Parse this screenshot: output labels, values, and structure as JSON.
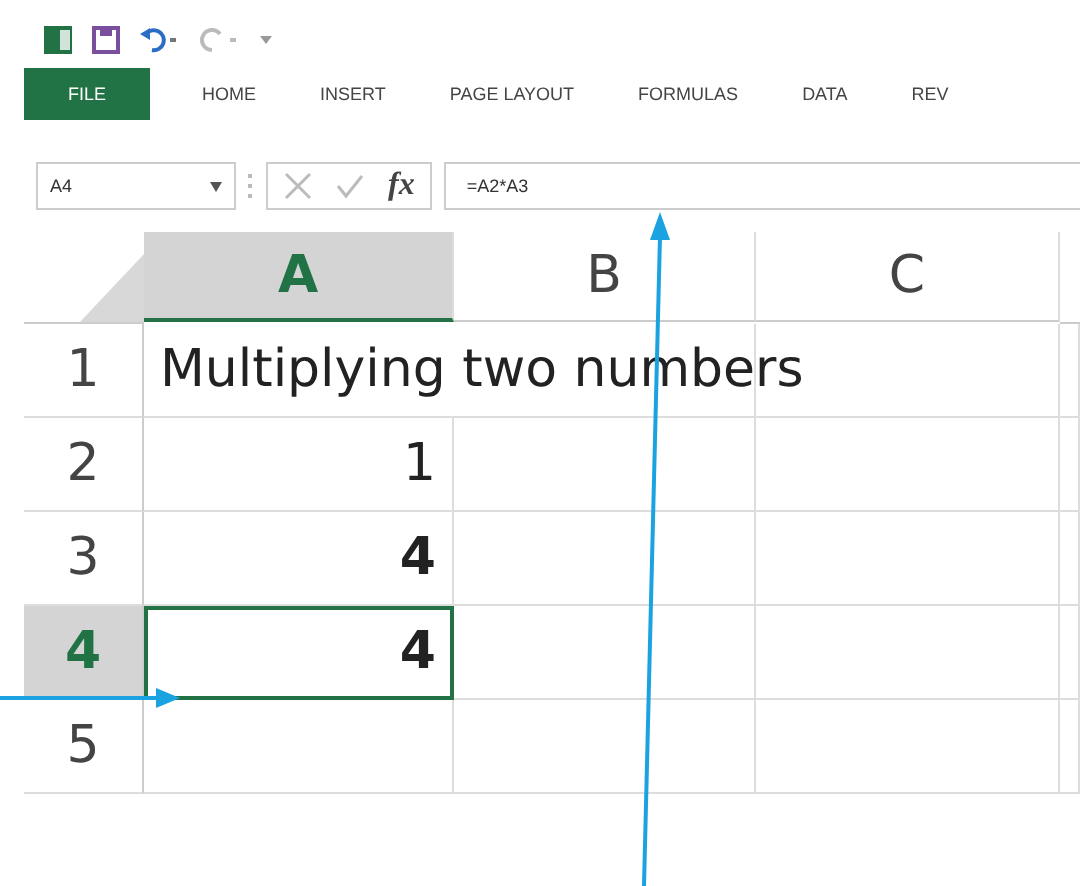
{
  "ribbon_tabs": [
    {
      "label": "FILE",
      "kind": "file"
    },
    {
      "label": "HOME",
      "kind": "tab"
    },
    {
      "label": "INSERT",
      "kind": "tab"
    },
    {
      "label": "PAGE LAYOUT",
      "kind": "tab"
    },
    {
      "label": "FORMULAS",
      "kind": "tab"
    },
    {
      "label": "DATA",
      "kind": "tab"
    },
    {
      "label": "REV",
      "kind": "tab"
    }
  ],
  "formula_bar": {
    "name_box": "A4",
    "function_label": "fx",
    "formula": "=A2*A3"
  },
  "columns": [
    {
      "label": "A",
      "selected": true
    },
    {
      "label": "B",
      "selected": false
    },
    {
      "label": "C",
      "selected": false
    }
  ],
  "rows": [
    {
      "header": "1",
      "selected": false,
      "cells": [
        {
          "kind": "text",
          "value": "Multiplying two numbers",
          "bold": false,
          "selected": false
        }
      ]
    },
    {
      "header": "2",
      "selected": false,
      "cells": [
        {
          "kind": "number",
          "value": "1",
          "bold": false,
          "selected": false
        }
      ]
    },
    {
      "header": "3",
      "selected": false,
      "cells": [
        {
          "kind": "number",
          "value": "4",
          "bold": true,
          "selected": false
        }
      ]
    },
    {
      "header": "4",
      "selected": true,
      "cells": [
        {
          "kind": "number",
          "value": "4",
          "bold": true,
          "selected": true
        }
      ]
    },
    {
      "header": "5",
      "selected": false,
      "cells": []
    }
  ]
}
